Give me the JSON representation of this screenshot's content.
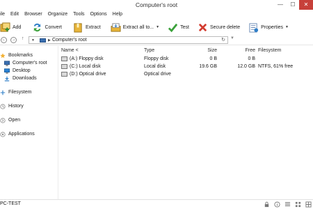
{
  "window": {
    "title": "Computer's root",
    "controls": {
      "minimize": "—",
      "maximize": "☐",
      "close": "✕"
    }
  },
  "menu": [
    "ile",
    "Edit",
    "Browser",
    "Organize",
    "Tools",
    "Options",
    "Help"
  ],
  "toolbar": {
    "add": "Add",
    "convert": "Convert",
    "extract": "Extract",
    "extract_all": "Extract all to...",
    "test": "Test",
    "secure_delete": "Secure delete",
    "properties": "Properties"
  },
  "address": {
    "path": "Computer's root"
  },
  "sidebar": {
    "bookmarks": "Bookmarks",
    "bookmark_items": [
      "Computer's root",
      "Desktop",
      "Downloads"
    ],
    "filesystem": "Filesystem",
    "history": "History",
    "open": "Open",
    "applications": "Applications"
  },
  "columns": {
    "name": "Name <",
    "type": "Type",
    "size": "Size",
    "free": "Free",
    "filesystem": "Filesystem"
  },
  "rows": [
    {
      "name": "(A:) Floppy disk",
      "type": "Floppy disk",
      "size": "0 B",
      "free": "0 B",
      "filesystem": ""
    },
    {
      "name": "(C:) Local disk",
      "type": "Local disk",
      "size": "19.6 GB",
      "free": "12.0 GB",
      "filesystem": "NTFS, 61% free"
    },
    {
      "name": "(D:) Optical drive",
      "type": "Optical drive",
      "size": "",
      "free": "",
      "filesystem": ""
    }
  ],
  "status": {
    "computer_name": "PC-TEST"
  },
  "colors": {
    "accent": "#3a6fb0",
    "close": "#c7403a",
    "bookmark": "#f2b134"
  }
}
